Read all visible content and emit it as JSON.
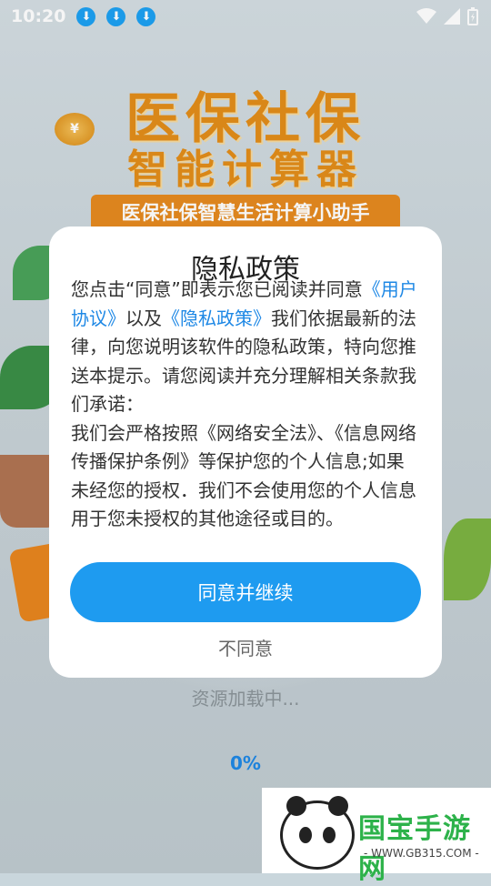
{
  "status_bar": {
    "time": "10:20",
    "download_icons": [
      "download-icon",
      "download-icon",
      "download-icon"
    ]
  },
  "splash": {
    "title": "医保社保",
    "subtitle": "智能计算器",
    "ribbon": "医保社保智慧生活计算小助手",
    "coin_symbol": "¥",
    "loading_text": "资源加载中...",
    "progress_label": "0%",
    "progress_value": 0
  },
  "dialog": {
    "title": "隐私政策",
    "para1_prefix": "您点击“同意”即表示您已阅读并同意",
    "user_agreement_link": "《用户协议》",
    "and_text": "以及",
    "privacy_link": "《隐私政策》",
    "para1_suffix": "我们依据最新的法律，向您说明该软件的隐私政策，特向您推送本提示。请您阅读并充分理解相关条款我们承诺：",
    "para2": "我们会严格按照《网络安全法》、《信息网络传播保护条例》等保护您的个人信息;如果未经您的授权．我们不会使用您的个人信息用于您未授权的其他途径或目的。",
    "agree_button": "同意并继续",
    "disagree_button": "不同意"
  },
  "watermark": {
    "brand": "国宝手游网",
    "url": "- WWW.GB315.COM -"
  },
  "colors": {
    "accent": "#1e9bf0",
    "link": "#1e88e5",
    "title_orange": "#e28d1a",
    "brand_green": "#2db24a"
  }
}
